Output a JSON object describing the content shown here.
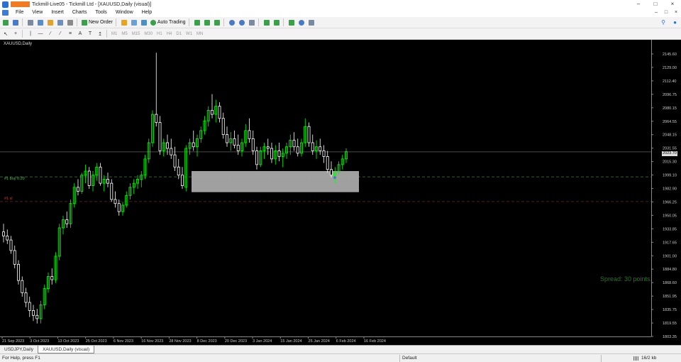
{
  "window": {
    "title": "Tickmill-Live05 - Tickmill Ltd - [XAUUSD,Daily (visual)]",
    "controls": [
      "–",
      "□",
      "×"
    ]
  },
  "menu": {
    "items": [
      "File",
      "View",
      "Insert",
      "Charts",
      "Tools",
      "Window",
      "Help"
    ],
    "right_controls": [
      "–",
      "□",
      "×"
    ]
  },
  "toolbar": {
    "new_order_label": "New Order",
    "auto_trading_label": "Auto Trading",
    "timeframes": [
      "M1",
      "M5",
      "M15",
      "M30",
      "H1",
      "H4",
      "D1",
      "W1",
      "MN"
    ]
  },
  "chart": {
    "symbol_label": "XAUUSD,Daily",
    "current_price": "2023.70",
    "buy_line_label": "#1 buy 0.20",
    "sl_line_label": "#1 sl",
    "spread_text": "Spread: 30 points.",
    "colors": {
      "background": "#000000",
      "bull": "#00ff00",
      "bear": "#ffffff",
      "buy_line": "#2e8b2e",
      "sl_line": "#8b1a1a",
      "zone": "#a9a9a9"
    }
  },
  "chart_data": {
    "type": "candlestick",
    "y_ticks": [
      "2145.60",
      "2129.00",
      "2112.40",
      "2096.75",
      "2080.15",
      "2064.55",
      "2048.15",
      "2031.55",
      "2015.30",
      "1999.10",
      "1982.90",
      "1966.25",
      "1950.05",
      "1933.85",
      "1917.65",
      "1901.00",
      "1884.80",
      "1868.60",
      "1851.95",
      "1835.75",
      "1819.55",
      "1803.35"
    ],
    "x_ticks": [
      "21 Sep 2023",
      "3 Oct 2023",
      "13 Oct 2023",
      "25 Oct 2023",
      "6 Nov 2023",
      "16 Nov 2023",
      "28 Nov 2023",
      "8 Dec 2023",
      "20 Dec 2023",
      "3 Jan 2024",
      "15 Jan 2024",
      "25 Jan 2024",
      "6 Feb 2024",
      "16 Feb 2024"
    ],
    "ylim": [
      1796,
      2162
    ],
    "current_price": 2023.7,
    "buy_level": 1992.9,
    "sl_level": 1962.5,
    "zone": {
      "price_top": 2000.0,
      "price_bottom": 1974.0
    },
    "candles": [
      {
        "o": 1925,
        "h": 1935,
        "l": 1912,
        "c": 1920
      },
      {
        "o": 1920,
        "h": 1928,
        "l": 1910,
        "c": 1915
      },
      {
        "o": 1915,
        "h": 1920,
        "l": 1898,
        "c": 1902
      },
      {
        "o": 1902,
        "h": 1908,
        "l": 1880,
        "c": 1885
      },
      {
        "o": 1885,
        "h": 1890,
        "l": 1860,
        "c": 1865
      },
      {
        "o": 1865,
        "h": 1870,
        "l": 1845,
        "c": 1850
      },
      {
        "o": 1850,
        "h": 1856,
        "l": 1832,
        "c": 1838
      },
      {
        "o": 1838,
        "h": 1845,
        "l": 1820,
        "c": 1828
      },
      {
        "o": 1828,
        "h": 1835,
        "l": 1815,
        "c": 1822
      },
      {
        "o": 1822,
        "h": 1830,
        "l": 1812,
        "c": 1818
      },
      {
        "o": 1818,
        "h": 1840,
        "l": 1812,
        "c": 1835
      },
      {
        "o": 1835,
        "h": 1860,
        "l": 1830,
        "c": 1855
      },
      {
        "o": 1855,
        "h": 1875,
        "l": 1850,
        "c": 1870
      },
      {
        "o": 1870,
        "h": 1880,
        "l": 1860,
        "c": 1866
      },
      {
        "o": 1866,
        "h": 1900,
        "l": 1862,
        "c": 1895
      },
      {
        "o": 1895,
        "h": 1935,
        "l": 1890,
        "c": 1930
      },
      {
        "o": 1930,
        "h": 1945,
        "l": 1922,
        "c": 1940
      },
      {
        "o": 1940,
        "h": 1950,
        "l": 1930,
        "c": 1935
      },
      {
        "o": 1935,
        "h": 1965,
        "l": 1930,
        "c": 1960
      },
      {
        "o": 1960,
        "h": 1985,
        "l": 1955,
        "c": 1980
      },
      {
        "o": 1980,
        "h": 1990,
        "l": 1970,
        "c": 1975
      },
      {
        "o": 1975,
        "h": 1998,
        "l": 1972,
        "c": 1995
      },
      {
        "o": 1995,
        "h": 2008,
        "l": 1985,
        "c": 2000
      },
      {
        "o": 2000,
        "h": 2005,
        "l": 1978,
        "c": 1982
      },
      {
        "o": 1982,
        "h": 2000,
        "l": 1975,
        "c": 1995
      },
      {
        "o": 1995,
        "h": 2010,
        "l": 1988,
        "c": 2005
      },
      {
        "o": 2005,
        "h": 2010,
        "l": 1982,
        "c": 1985
      },
      {
        "o": 1985,
        "h": 1995,
        "l": 1975,
        "c": 1990
      },
      {
        "o": 1990,
        "h": 1998,
        "l": 1980,
        "c": 1985
      },
      {
        "o": 1985,
        "h": 1990,
        "l": 1962,
        "c": 1965
      },
      {
        "o": 1965,
        "h": 1975,
        "l": 1955,
        "c": 1960
      },
      {
        "o": 1960,
        "h": 1965,
        "l": 1945,
        "c": 1950
      },
      {
        "o": 1950,
        "h": 1962,
        "l": 1945,
        "c": 1958
      },
      {
        "o": 1958,
        "h": 1975,
        "l": 1955,
        "c": 1970
      },
      {
        "o": 1970,
        "h": 1985,
        "l": 1965,
        "c": 1980
      },
      {
        "o": 1980,
        "h": 1990,
        "l": 1972,
        "c": 1985
      },
      {
        "o": 1985,
        "h": 1995,
        "l": 1978,
        "c": 1990
      },
      {
        "o": 1990,
        "h": 2000,
        "l": 1980,
        "c": 1995
      },
      {
        "o": 1995,
        "h": 2020,
        "l": 1990,
        "c": 2015
      },
      {
        "o": 2015,
        "h": 2040,
        "l": 2010,
        "c": 2035
      },
      {
        "o": 2035,
        "h": 2075,
        "l": 2030,
        "c": 2070
      },
      {
        "o": 2070,
        "h": 2146,
        "l": 2055,
        "c": 2060
      },
      {
        "o": 2060,
        "h": 2068,
        "l": 2020,
        "c": 2025
      },
      {
        "o": 2025,
        "h": 2040,
        "l": 2018,
        "c": 2035
      },
      {
        "o": 2035,
        "h": 2045,
        "l": 2020,
        "c": 2028
      },
      {
        "o": 2028,
        "h": 2040,
        "l": 2015,
        "c": 2020
      },
      {
        "o": 2020,
        "h": 2030,
        "l": 2000,
        "c": 2005
      },
      {
        "o": 2005,
        "h": 2015,
        "l": 1990,
        "c": 1995
      },
      {
        "o": 1995,
        "h": 2005,
        "l": 1978,
        "c": 1982
      },
      {
        "o": 1980,
        "h": 2032,
        "l": 1975,
        "c": 2028
      },
      {
        "o": 2028,
        "h": 2040,
        "l": 2020,
        "c": 2035
      },
      {
        "o": 2035,
        "h": 2050,
        "l": 2025,
        "c": 2030
      },
      {
        "o": 2030,
        "h": 2045,
        "l": 2018,
        "c": 2040
      },
      {
        "o": 2040,
        "h": 2055,
        "l": 2035,
        "c": 2050
      },
      {
        "o": 2050,
        "h": 2068,
        "l": 2045,
        "c": 2062
      },
      {
        "o": 2062,
        "h": 2080,
        "l": 2055,
        "c": 2075
      },
      {
        "o": 2075,
        "h": 2095,
        "l": 2065,
        "c": 2070
      },
      {
        "o": 2070,
        "h": 2088,
        "l": 2060,
        "c": 2080
      },
      {
        "o": 2080,
        "h": 2085,
        "l": 2060,
        "c": 2065
      },
      {
        "o": 2065,
        "h": 2072,
        "l": 2040,
        "c": 2045
      },
      {
        "o": 2045,
        "h": 2055,
        "l": 2030,
        "c": 2035
      },
      {
        "o": 2035,
        "h": 2048,
        "l": 2025,
        "c": 2040
      },
      {
        "o": 2040,
        "h": 2050,
        "l": 2028,
        "c": 2032
      },
      {
        "o": 2032,
        "h": 2045,
        "l": 2020,
        "c": 2025
      },
      {
        "o": 2025,
        "h": 2040,
        "l": 2018,
        "c": 2035
      },
      {
        "o": 2035,
        "h": 2058,
        "l": 2030,
        "c": 2050
      },
      {
        "o": 2050,
        "h": 2065,
        "l": 2035,
        "c": 2040
      },
      {
        "o": 2040,
        "h": 2050,
        "l": 2020,
        "c": 2025
      },
      {
        "o": 2025,
        "h": 2030,
        "l": 2002,
        "c": 2008
      },
      {
        "o": 2008,
        "h": 2030,
        "l": 2005,
        "c": 2025
      },
      {
        "o": 2025,
        "h": 2035,
        "l": 2015,
        "c": 2030
      },
      {
        "o": 2030,
        "h": 2040,
        "l": 2020,
        "c": 2028
      },
      {
        "o": 2028,
        "h": 2035,
        "l": 2010,
        "c": 2015
      },
      {
        "o": 2015,
        "h": 2032,
        "l": 2008,
        "c": 2025
      },
      {
        "o": 2025,
        "h": 2035,
        "l": 2012,
        "c": 2018
      },
      {
        "o": 2018,
        "h": 2028,
        "l": 2005,
        "c": 2022
      },
      {
        "o": 2022,
        "h": 2035,
        "l": 2015,
        "c": 2030
      },
      {
        "o": 2030,
        "h": 2045,
        "l": 2020,
        "c": 2038
      },
      {
        "o": 2038,
        "h": 2048,
        "l": 2025,
        "c": 2030
      },
      {
        "o": 2030,
        "h": 2040,
        "l": 2018,
        "c": 2022
      },
      {
        "o": 2022,
        "h": 2040,
        "l": 2018,
        "c": 2035
      },
      {
        "o": 2035,
        "h": 2065,
        "l": 2030,
        "c": 2055
      },
      {
        "o": 2055,
        "h": 2060,
        "l": 2030,
        "c": 2035
      },
      {
        "o": 2035,
        "h": 2045,
        "l": 2020,
        "c": 2025
      },
      {
        "o": 2025,
        "h": 2038,
        "l": 2015,
        "c": 2030
      },
      {
        "o": 2030,
        "h": 2040,
        "l": 2020,
        "c": 2025
      },
      {
        "o": 2025,
        "h": 2032,
        "l": 2010,
        "c": 2018
      },
      {
        "o": 2018,
        "h": 2025,
        "l": 1998,
        "c": 2002
      },
      {
        "o": 2002,
        "h": 2012,
        "l": 1992,
        "c": 1995
      },
      {
        "o": 1995,
        "h": 2005,
        "l": 1985,
        "c": 1998
      },
      {
        "o": 1998,
        "h": 2012,
        "l": 1995,
        "c": 2008
      },
      {
        "o": 2008,
        "h": 2020,
        "l": 2002,
        "c": 2015
      },
      {
        "o": 2015,
        "h": 2028,
        "l": 2010,
        "c": 2024
      }
    ]
  },
  "tabs": [
    "USDJPY,Daily",
    "XAUUSD,Daily (visual)"
  ],
  "status": {
    "help": "For Help, press F1",
    "profile": "Default",
    "traffic": "16/2 kb"
  }
}
